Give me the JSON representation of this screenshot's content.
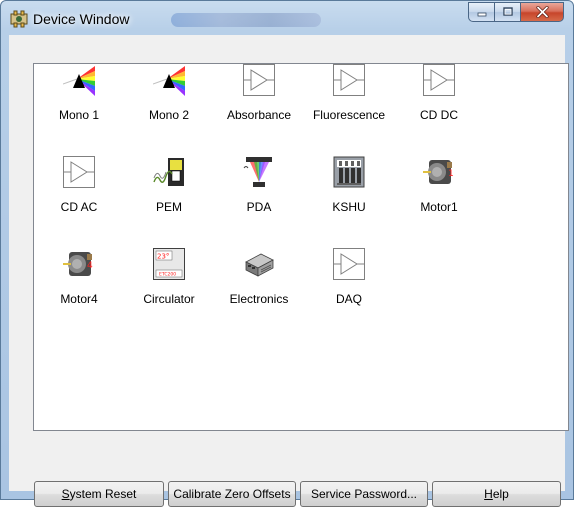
{
  "window": {
    "title": "Device Window",
    "icon": "device-window-icon",
    "caption_buttons": [
      "minimize-icon",
      "maximize-icon",
      "close-icon"
    ]
  },
  "devices": [
    {
      "label": "Mono 1",
      "icon": "mono1-icon"
    },
    {
      "label": "Mono 2",
      "icon": "mono2-icon"
    },
    {
      "label": "Absorbance",
      "icon": "detector-triangle-icon"
    },
    {
      "label": "Fluorescence",
      "icon": "detector-triangle-icon"
    },
    {
      "label": "CD DC",
      "icon": "detector-triangle-icon"
    },
    {
      "label": "CD AC",
      "icon": "detector-triangle-icon"
    },
    {
      "label": "PEM",
      "icon": "pem-icon"
    },
    {
      "label": "PDA",
      "icon": "pda-icon"
    },
    {
      "label": "KSHU",
      "icon": "kshu-icon"
    },
    {
      "label": "Motor1",
      "icon": "motor-icon"
    },
    {
      "label": "Motor4",
      "icon": "motor-icon"
    },
    {
      "label": "Circulator",
      "icon": "circulator-icon"
    },
    {
      "label": "Electronics",
      "icon": "electronics-icon"
    },
    {
      "label": "DAQ",
      "icon": "detector-triangle-icon"
    }
  ],
  "icon_text": {
    "motor1_num": "1",
    "motor4_num": "4",
    "circulator_temp": "23°",
    "circulator_model": "ETC200"
  },
  "buttons": {
    "system_reset": {
      "mnemonic": "S",
      "rest": "ystem Reset"
    },
    "calibrate": "Calibrate Zero Offsets",
    "service_password": "Service Password...",
    "help": {
      "mnemonic": "H",
      "rest": "elp"
    }
  },
  "colors": {
    "title_bar": "#b7cfe8",
    "panel_bg": "#ffffff",
    "dialog_bg": "#f0f0f0",
    "close_button": "#c7452b"
  }
}
